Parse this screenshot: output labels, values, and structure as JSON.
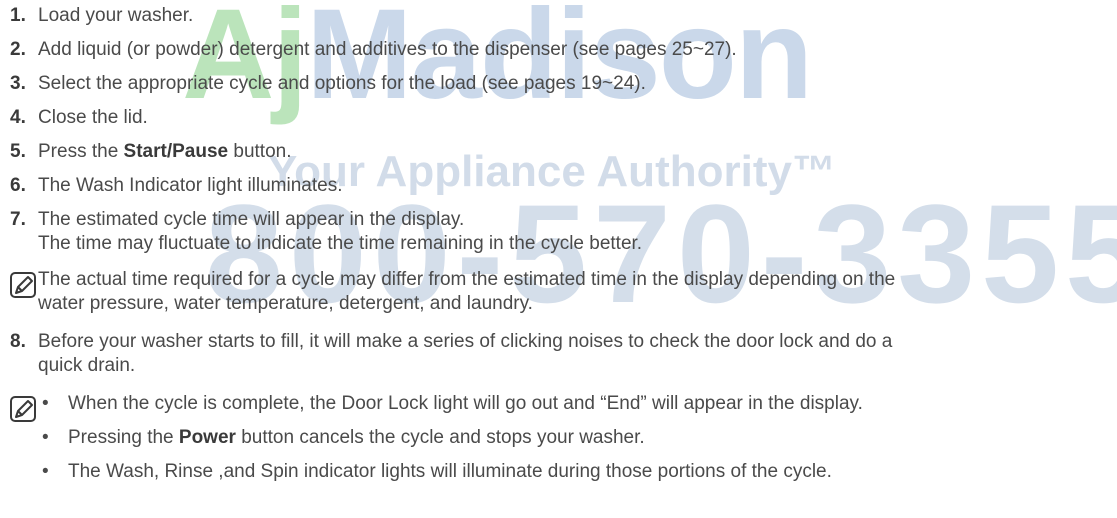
{
  "watermark": {
    "brand": "AJMadison",
    "tagline": "Your Appliance Authority™",
    "phone": "800-570-3355"
  },
  "steps": [
    {
      "num": "1.",
      "text": "Load your washer."
    },
    {
      "num": "2.",
      "text": "Add liquid (or powder) detergent and additives to the dispenser (see pages 25~27)."
    },
    {
      "num": "3.",
      "text": "Select the appropriate cycle and options for the load (see pages 19~24)."
    },
    {
      "num": "4.",
      "text": "Close the lid."
    },
    {
      "num": "5.",
      "pre": "Press the ",
      "bold": "Start/Pause",
      "post": " button."
    },
    {
      "num": "6.",
      "text": "The Wash Indicator light illuminates."
    },
    {
      "num": "7.",
      "text": "The estimated cycle time will appear in the display.",
      "cont": "The time may fluctuate to indicate the time remaining in the cycle better."
    },
    {
      "num": "8.",
      "text": "Before your washer starts to fill, it will make a series of clicking noises to check the door lock and do a",
      "cont": "quick drain."
    }
  ],
  "note1": {
    "line1": "The actual time required for a cycle may differ from the estimated time in the display depending on the",
    "line2": "water pressure, water temperature, detergent, and laundry."
  },
  "note2": {
    "bullets": [
      {
        "text": "When the cycle is complete, the Door Lock light will go out and “End” will appear in the display."
      },
      {
        "pre": "Pressing the ",
        "bold": "Power",
        "post": " button cancels the cycle and stops your washer."
      },
      {
        "text": "The Wash, Rinse ,and Spin indicator lights will illuminate during those portions of the cycle."
      }
    ]
  },
  "colors": {
    "text": "#4a4a4a",
    "watermark_green": "#8fd38f",
    "watermark_blue": "#9fb8d6"
  }
}
